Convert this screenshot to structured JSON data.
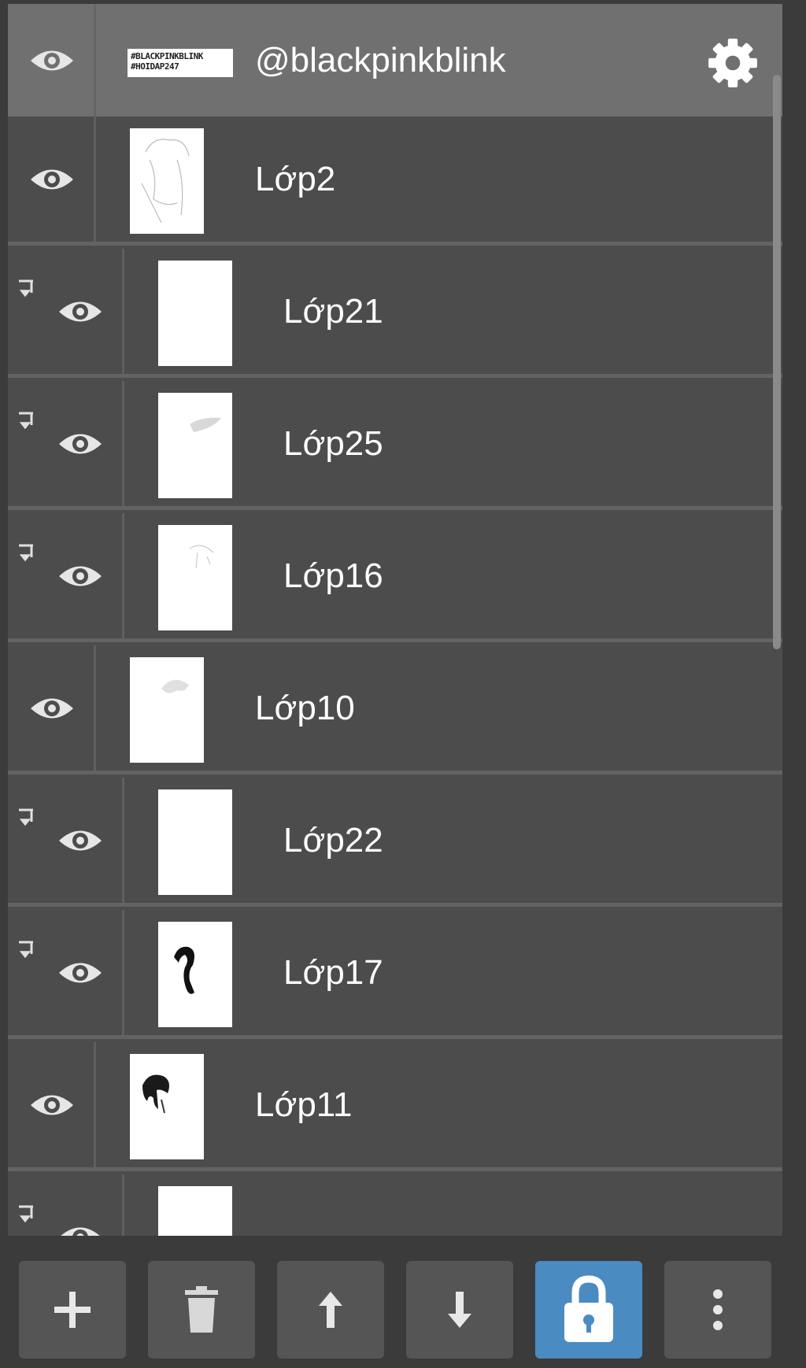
{
  "group": {
    "name": "@blackpinkblink",
    "thumb_text": [
      "#BLACKPINKBLINK",
      "#HOIDAP247"
    ]
  },
  "layers": [
    {
      "name": "Lớp2",
      "clipped": false,
      "thumb": "sketch"
    },
    {
      "name": "Lớp21",
      "clipped": true,
      "thumb": "blank"
    },
    {
      "name": "Lớp25",
      "clipped": true,
      "thumb": "smudge"
    },
    {
      "name": "Lớp16",
      "clipped": true,
      "thumb": "faint-sketch"
    },
    {
      "name": "Lớp10",
      "clipped": false,
      "thumb": "faint-hair"
    },
    {
      "name": "Lớp22",
      "clipped": true,
      "thumb": "blank"
    },
    {
      "name": "Lớp17",
      "clipped": true,
      "thumb": "hair-strand"
    },
    {
      "name": "Lớp11",
      "clipped": false,
      "thumb": "hair-dark"
    },
    {
      "name": "",
      "clipped": true,
      "thumb": "blank"
    }
  ],
  "icons": {
    "visibility": "eye-icon",
    "settings": "gear-icon",
    "clipping": "clip-arrow-icon"
  },
  "toolbar": {
    "buttons": [
      {
        "icon": "plus-icon",
        "active": false
      },
      {
        "icon": "trash-icon",
        "active": false
      },
      {
        "icon": "arrow-up-icon",
        "active": false
      },
      {
        "icon": "arrow-down-icon",
        "active": false
      },
      {
        "icon": "lock-icon",
        "active": true
      },
      {
        "icon": "more-vertical-icon",
        "active": false
      }
    ]
  },
  "colors": {
    "panel": "#4c4c4c",
    "group_row": "#707070",
    "accent": "#4a8bc2"
  }
}
